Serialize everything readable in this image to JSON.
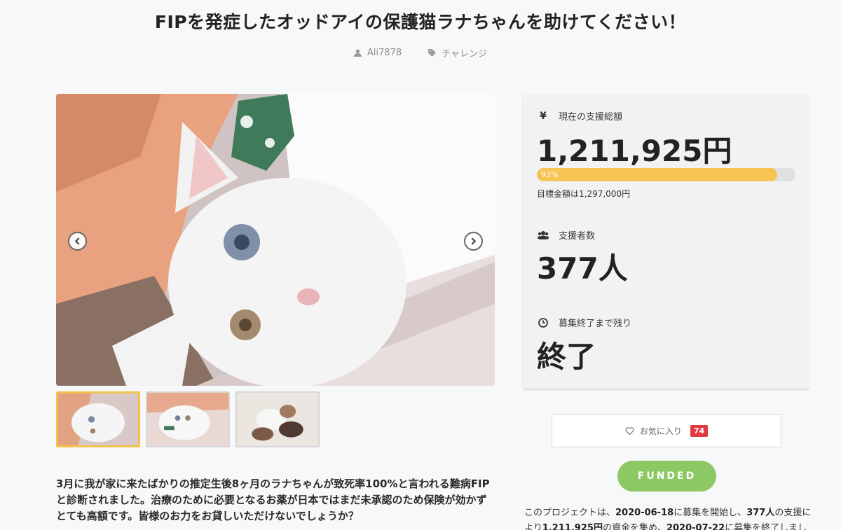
{
  "title": "FIPを発症したオッドアイの保護猫ラナちゃんを助けてください！",
  "meta": {
    "author": "Ali7878",
    "category": "チャレンジ"
  },
  "gallery": {
    "prev_icon": "chevron-left-icon",
    "next_icon": "chevron-right-icon",
    "thumb_count": 3
  },
  "description": {
    "line1": "3月に我が家に来たばかりの推定生後8ヶ月のラナちゃんが致死率100%と言われる難病FIP",
    "line2": "と診断されました。治療のために必要となるお薬が日本ではまだ未承認のため保険が効かず",
    "line3": "とても高額です。皆様のお力をお貸しいただけないでしょうか？"
  },
  "stats": {
    "total_label": "現在の支援総額",
    "total_icon": "yen-icon",
    "total_value": "1,211,925円",
    "progress_percent": 93,
    "progress_label": "93%",
    "goal_text": "目標金額は1,297,000円",
    "supporters_label": "支援者数",
    "supporters_icon": "users-icon",
    "supporters_value": "377人",
    "remaining_label": "募集終了まで残り",
    "remaining_icon": "clock-icon",
    "remaining_value": "終了"
  },
  "favorite": {
    "label": "お気に入り",
    "count": "74",
    "icon": "heart-icon"
  },
  "funded_label": "FUNDED",
  "summary": {
    "s1": "このプロジェクトは、",
    "start_date": "2020-06-18",
    "s2": "に募集を開始し、",
    "supporters": "377人",
    "s3": "の支援に",
    "s4": "より",
    "amount": "1,211,925円",
    "s5": "の資金を集め、",
    "end_date": "2020-07-22",
    "s6": "に募集を終了しました。"
  },
  "colors": {
    "accent": "#f6c453",
    "funded": "#8cc863",
    "badge": "#e2383f"
  }
}
